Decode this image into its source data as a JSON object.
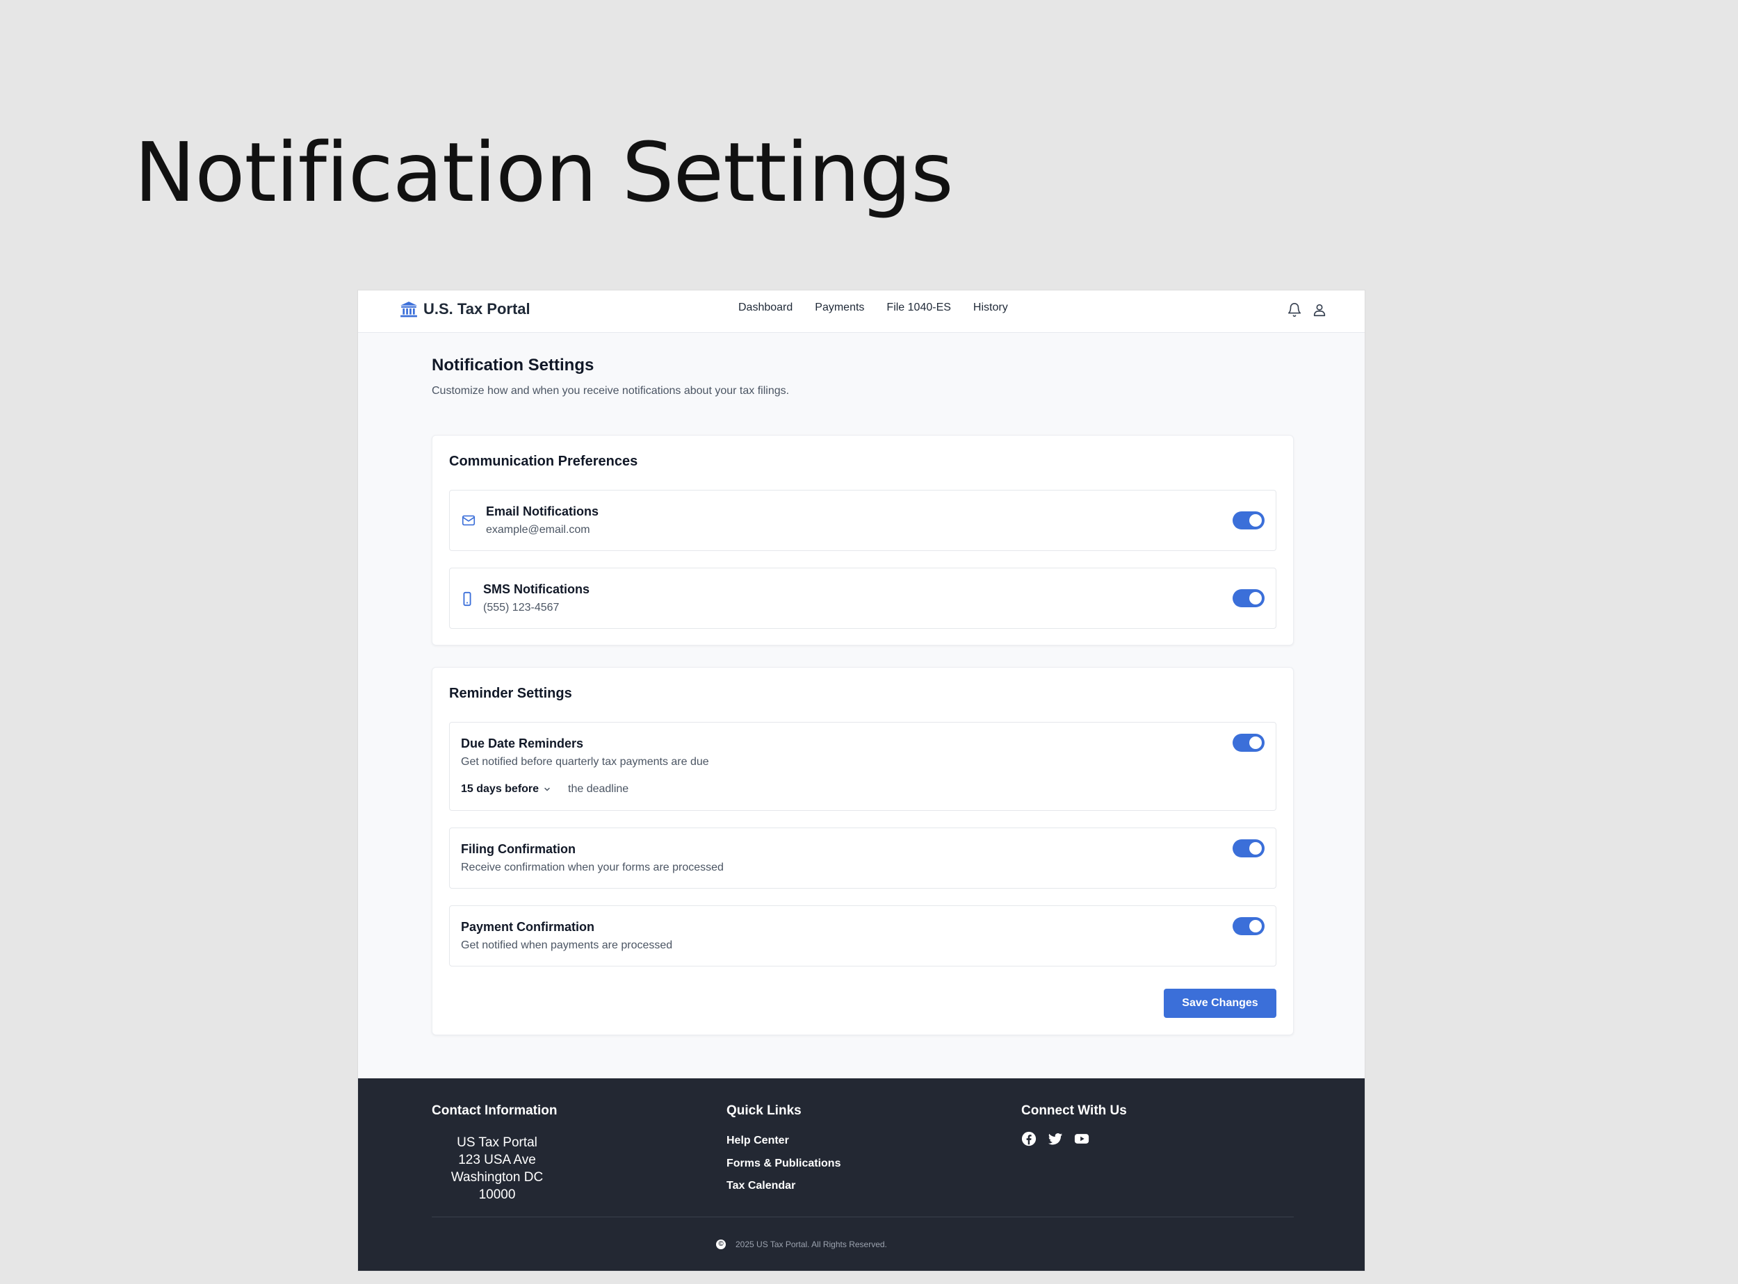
{
  "slide": {
    "title": "Notification Settings"
  },
  "header": {
    "brand": "U.S. Tax Portal",
    "nav": [
      "Dashboard",
      "Payments",
      "File 1040-ES",
      "History"
    ]
  },
  "page": {
    "title": "Notification Settings",
    "subtitle": "Customize how and when you receive notifications about your tax filings."
  },
  "communication": {
    "heading": "Communication Preferences",
    "email": {
      "title": "Email Notifications",
      "detail": "example@email.com",
      "enabled": true
    },
    "sms": {
      "title": "SMS Notifications",
      "detail": "(555) 123-4567",
      "enabled": true
    }
  },
  "reminders": {
    "heading": "Reminder Settings",
    "due_date": {
      "title": "Due Date Reminders",
      "detail": "Get notified before quarterly tax payments are due",
      "enabled": true,
      "select_value": "15 days before",
      "select_suffix": "the deadline"
    },
    "filing": {
      "title": "Filing Confirmation",
      "detail": "Receive confirmation when your forms are processed",
      "enabled": true
    },
    "payment": {
      "title": "Payment Confirmation",
      "detail": "Get notified when payments are processed",
      "enabled": true
    },
    "save_label": "Save Changes"
  },
  "footer": {
    "contact_heading": "Contact Information",
    "contact_lines": [
      "US Tax Portal",
      "123 USA Ave",
      "Washington DC 10000"
    ],
    "links_heading": "Quick Links",
    "links": [
      "Help Center",
      "Forms & Publications",
      "Tax Calendar"
    ],
    "social_heading": "Connect With Us",
    "social_icons": [
      "facebook-icon",
      "twitter-icon",
      "youtube-icon"
    ],
    "copyright": "2025 US Tax Portal. All Rights Reserved."
  },
  "colors": {
    "accent": "#3b6fd9",
    "footer_bg": "#232833",
    "page_bg": "#f8f9fb"
  }
}
